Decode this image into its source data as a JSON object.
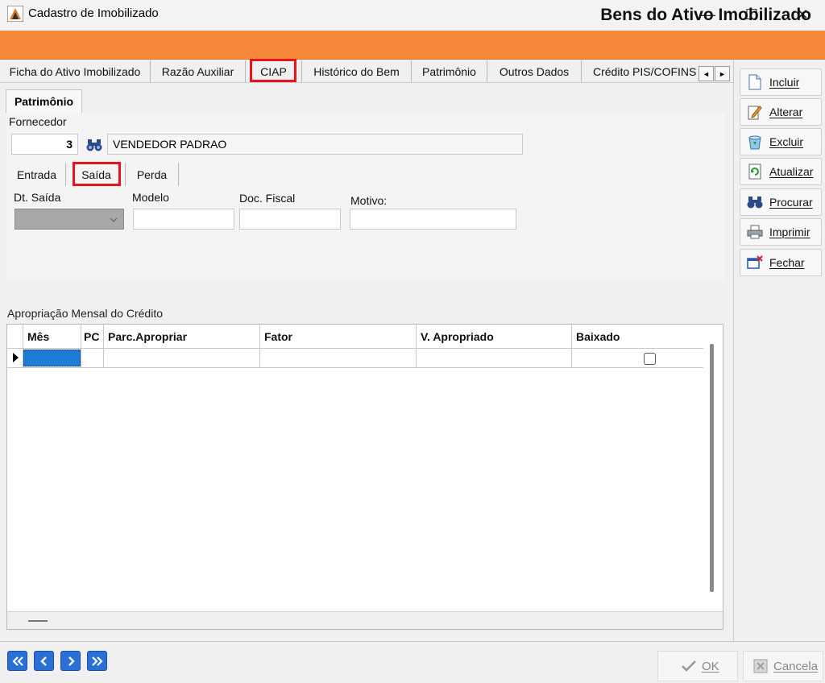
{
  "window": {
    "title": "Cadastro de Imobilizado",
    "minimize_glyph": "—",
    "maximize_glyph": "☐",
    "close_glyph": "✕"
  },
  "banner": {
    "title": "Bens do Ativo Imobilizado",
    "color": "#f6883a"
  },
  "main_tabs": [
    {
      "label": "Ficha do Ativo Imobilizado"
    },
    {
      "label": "Razão Auxiliar"
    },
    {
      "label": "CIAP",
      "highlighted": true
    },
    {
      "label": "Histórico do Bem"
    },
    {
      "label": "Patrimônio"
    },
    {
      "label": "Outros Dados"
    },
    {
      "label": "Crédito PIS/COFINS"
    }
  ],
  "tab_scroll": {
    "left": "◄",
    "right": "►"
  },
  "subpanel": {
    "tab": "Patrimônio",
    "fornecedor_label": "Fornecedor",
    "fornecedor_code": "3",
    "fornecedor_name": "VENDEDOR PADRAO"
  },
  "sub_tabs": [
    {
      "label": "Entrada"
    },
    {
      "label": "Saída",
      "highlighted": true
    },
    {
      "label": "Perda"
    }
  ],
  "saida_fields": {
    "dt_saida_label": "Dt. Saída",
    "modelo_label": "Modelo",
    "doc_fiscal_label": "Doc. Fiscal",
    "motivo_label": "Motivo:"
  },
  "grid": {
    "section_label": "Apropriação Mensal do Crédito",
    "columns": [
      "Mês",
      "PC",
      "Parc.Apropriar",
      "Fator",
      "V. Apropriado",
      "Baixado"
    ]
  },
  "toolbar": {
    "incluir": "Incluir",
    "alterar": "Alterar",
    "excluir": "Excluir",
    "atualizar": "Atualizar",
    "procurar": "Procurar",
    "imprimir": "Imprimir",
    "fechar": "Fechar"
  },
  "footer": {
    "first": "«",
    "prev": "‹",
    "next": "›",
    "last": "»",
    "ok": "OK",
    "cancela": "Cancela"
  },
  "colors": {
    "highlight": "#e8141c",
    "selection": "#1e7bd6",
    "nav": "#2a6fd6"
  }
}
